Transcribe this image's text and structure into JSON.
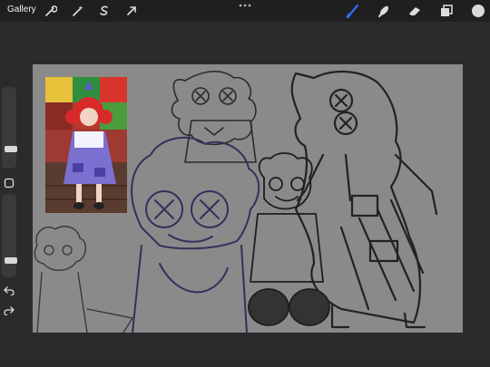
{
  "topbar": {
    "gallery_label": "Gallery",
    "left_tools": [
      "wrench-icon",
      "magic-wand-icon",
      "selection-icon",
      "transform-arrow-icon"
    ],
    "right_tools": [
      "brush-icon",
      "smudge-icon",
      "eraser-icon",
      "layers-icon",
      "color-swatch"
    ],
    "active_tool_color": "#2f6df0",
    "current_color": "#d9d9d9"
  },
  "sidebar": {
    "brush_size_level": 0.25,
    "opacity_level": 0.2,
    "buttons": [
      "modify-square-icon",
      "undo-icon",
      "redo-icon"
    ]
  },
  "canvas": {
    "background": "#8a8a8a",
    "content": "sketch-artwork",
    "reference_image": "reference-photo"
  }
}
